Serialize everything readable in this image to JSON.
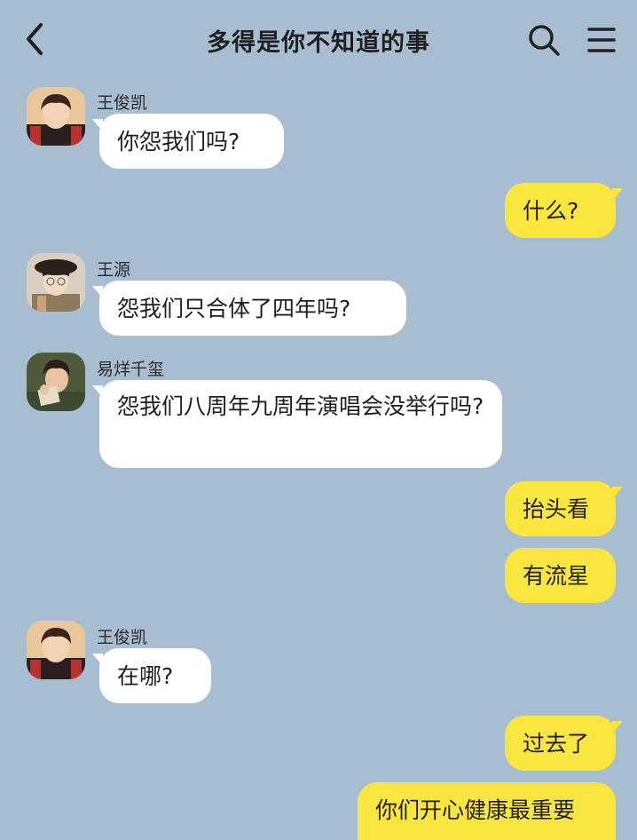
{
  "header": {
    "title": "多得是你不知道的事"
  },
  "messages": [
    {
      "sender": "王俊凯",
      "text": "你怨我们吗?"
    },
    {
      "text": "什么?"
    },
    {
      "sender": "王源",
      "text": "怨我们只合体了四年吗?"
    },
    {
      "sender": "易烊千玺",
      "text": "怨我们八周年九周年演唱会没举行吗?"
    },
    {
      "text": "抬头看"
    },
    {
      "text": "有流星"
    },
    {
      "sender": "王俊凯",
      "text": "在哪?"
    },
    {
      "text": "过去了"
    },
    {
      "text": "你们开心健康最重要"
    }
  ],
  "colors": {
    "background": "#a8bdd0",
    "incoming_bubble": "#ffffff",
    "outgoing_bubble": "#fbe640"
  },
  "icons": [
    "back-arrow-icon",
    "search-icon",
    "menu-icon",
    "avatar-wangjunkai",
    "avatar-wangyuan",
    "avatar-yiyangqianxi"
  ]
}
